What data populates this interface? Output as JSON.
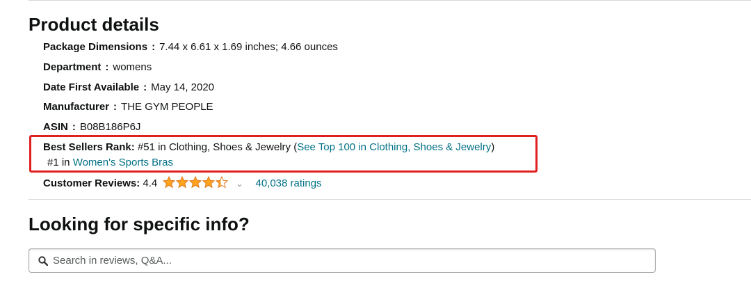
{
  "product_details": {
    "heading": "Product details",
    "package_dimensions": {
      "label": "Package Dimensions",
      "colon": ":",
      "value": "7.44 x 6.61 x 1.69 inches; 4.66 ounces"
    },
    "department": {
      "label": "Department",
      "colon": ":",
      "value": "womens"
    },
    "date_first_available": {
      "label": "Date First Available",
      "colon": ":",
      "value": "May 14, 2020"
    },
    "manufacturer": {
      "label": "Manufacturer",
      "colon": ":",
      "value": "THE GYM PEOPLE"
    },
    "asin": {
      "label": "ASIN",
      "colon": ":",
      "value": "B08B186P6J"
    },
    "best_sellers_rank": {
      "label": "Best Sellers Rank:",
      "rank1_text": " #51 in Clothing, Shoes & Jewelry (",
      "rank1_link": "See Top 100 in Clothing, Shoes & Jewelry",
      "rank1_close": ")",
      "rank2_text": "#1 in ",
      "rank2_link": "Women's Sports Bras"
    },
    "customer_reviews": {
      "label": "Customer Reviews:",
      "rating": "4.4",
      "stars_value": 4.4,
      "stars_max": 5,
      "ratings_link": "40,038 ratings"
    }
  },
  "looking_for_info": {
    "heading": "Looking for specific info?",
    "search_placeholder": "Search in reviews, Q&A..."
  },
  "colors": {
    "link": "#007185",
    "star": "#ffa41c",
    "highlight_box": "#e02020"
  },
  "icons": [
    "star-icon",
    "chevron-down-icon",
    "search-icon"
  ]
}
